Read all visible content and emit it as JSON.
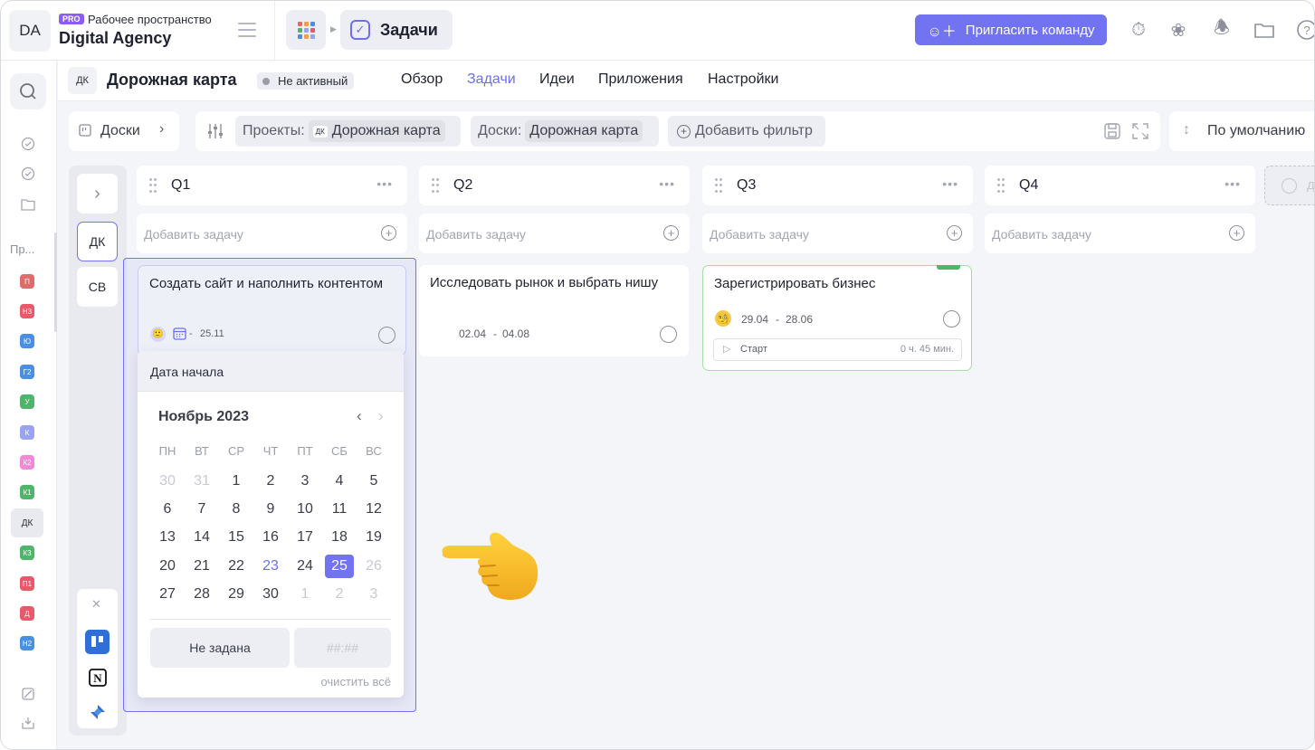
{
  "topbar": {
    "workspace_avatar": "DA",
    "pro_badge": "PRO",
    "workspace_label": "Рабочее пространство",
    "workspace_name": "Digital Agency",
    "current_section": "Задачи",
    "invite_label": "Пригласить команду",
    "icons": [
      "timer-icon",
      "lotus-icon",
      "bell-icon",
      "folder-icon",
      "help-icon"
    ]
  },
  "rail": {
    "projects_label": "Пр...",
    "projects": [
      {
        "code": "П",
        "color": "#e06b6b"
      },
      {
        "code": "Н3",
        "color": "#e85a6a"
      },
      {
        "code": "Ю",
        "color": "#4a90e2"
      },
      {
        "code": "Г2",
        "color": "#4a90e2"
      },
      {
        "code": "У",
        "color": "#4fb56a"
      },
      {
        "code": "К",
        "color": "#9aa3f0"
      },
      {
        "code": "К2",
        "color": "#f08ad6"
      },
      {
        "code": "К1",
        "color": "#4fb56a"
      },
      {
        "code": "ДК",
        "color": "#e9eaef"
      },
      {
        "code": "К3",
        "color": "#4fb56a"
      },
      {
        "code": "П1",
        "color": "#e85a6a"
      },
      {
        "code": "Д",
        "color": "#e85a6a"
      },
      {
        "code": "Н2",
        "color": "#4a90e2"
      }
    ]
  },
  "project": {
    "badge": "ДК",
    "title": "Дорожная карта",
    "status": "Не активный",
    "tabs": [
      "Обзор",
      "Задачи",
      "Идеи",
      "Приложения",
      "Настройки"
    ],
    "active_tab": "Задачи"
  },
  "filters": {
    "boards_label": "Доски",
    "projects_key": "Проекты:",
    "projects_badge": "ДК",
    "projects_value": "Дорожная карта",
    "boards_key": "Доски:",
    "boards_value": "Дорожная карта",
    "add_filter": "Добавить фильтр",
    "sort_label": "По умолчанию"
  },
  "boards_side": {
    "items": [
      "ДК",
      "СВ"
    ],
    "apps": [
      "trello-icon",
      "notion-icon",
      "jira-icon"
    ]
  },
  "columns": [
    {
      "name": "Q1",
      "add_placeholder": "Добавить задачу"
    },
    {
      "name": "Q2",
      "add_placeholder": "Добавить задачу"
    },
    {
      "name": "Q3",
      "add_placeholder": "Добавить задачу"
    },
    {
      "name": "Q4",
      "add_placeholder": "Добавить задачу"
    }
  ],
  "add_column_label": "д",
  "cards": {
    "q1": {
      "title": "Создать сайт и наполнить контентом",
      "date_sep": "-",
      "date_end": "25.11"
    },
    "q2": {
      "title": "Исследовать рынок и выбрать нишу",
      "date_start": "02.04",
      "date_sep": "-",
      "date_end": "04.08"
    },
    "q3": {
      "title": "Зарегистрировать бизнес",
      "date_start": "29.04",
      "date_sep": "-",
      "date_end": "28.06",
      "timer_start": "Старт",
      "timer_value": "0 ч. 45 мин."
    }
  },
  "datepicker": {
    "header": "Дата начала",
    "month": "Ноябрь 2023",
    "weekdays": [
      "ПН",
      "ВТ",
      "СР",
      "ЧТ",
      "ПТ",
      "СБ",
      "ВС"
    ],
    "weeks": [
      [
        "30",
        "31",
        "1",
        "2",
        "3",
        "4",
        "5"
      ],
      [
        "6",
        "7",
        "8",
        "9",
        "10",
        "11",
        "12"
      ],
      [
        "13",
        "14",
        "15",
        "16",
        "17",
        "18",
        "19"
      ],
      [
        "20",
        "21",
        "22",
        "23",
        "24",
        "25",
        "26"
      ],
      [
        "27",
        "28",
        "29",
        "30",
        "1",
        "2",
        "3"
      ]
    ],
    "today": "23",
    "selected": "25",
    "not_set": "Не задана",
    "time_placeholder": "##:##",
    "clear_all": "очистить всё"
  },
  "colors": {
    "accent": "#7173f0",
    "pro": "#8b5cf6",
    "green": "#4fb56a"
  }
}
